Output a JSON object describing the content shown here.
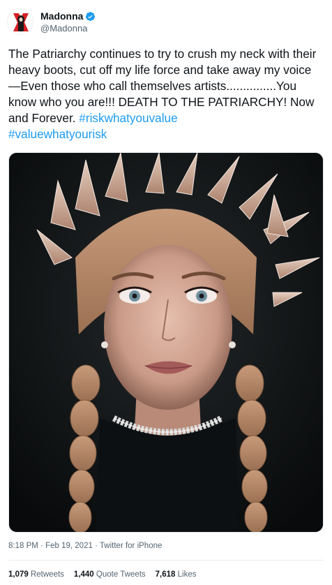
{
  "author": {
    "name": "Madonna",
    "handle": "@Madonna"
  },
  "tweet": {
    "text": "The Patriarchy continues to try to crush my neck with their heavy boots, cut off my life force and take away my voice—Even those who call themselves artists...............You know who you are!!! DEATH TO THE PATRIARCHY! Now and Forever. ",
    "hashtag1": "#riskwhatyouvalue",
    "hashtag2": "#valuewhatyourisk"
  },
  "meta": {
    "time": "8:18 PM",
    "date": "Feb 19, 2021",
    "source": "Twitter for iPhone",
    "separator": "·"
  },
  "stats": {
    "retweets_count": "1,079",
    "retweets_label": "Retweets",
    "quotes_count": "1,440",
    "quotes_label": "Quote Tweets",
    "likes_count": "7,618",
    "likes_label": "Likes"
  },
  "colors": {
    "link": "#1d9bf0",
    "verified": "#1d9bf0",
    "secondary_text": "#536471"
  }
}
